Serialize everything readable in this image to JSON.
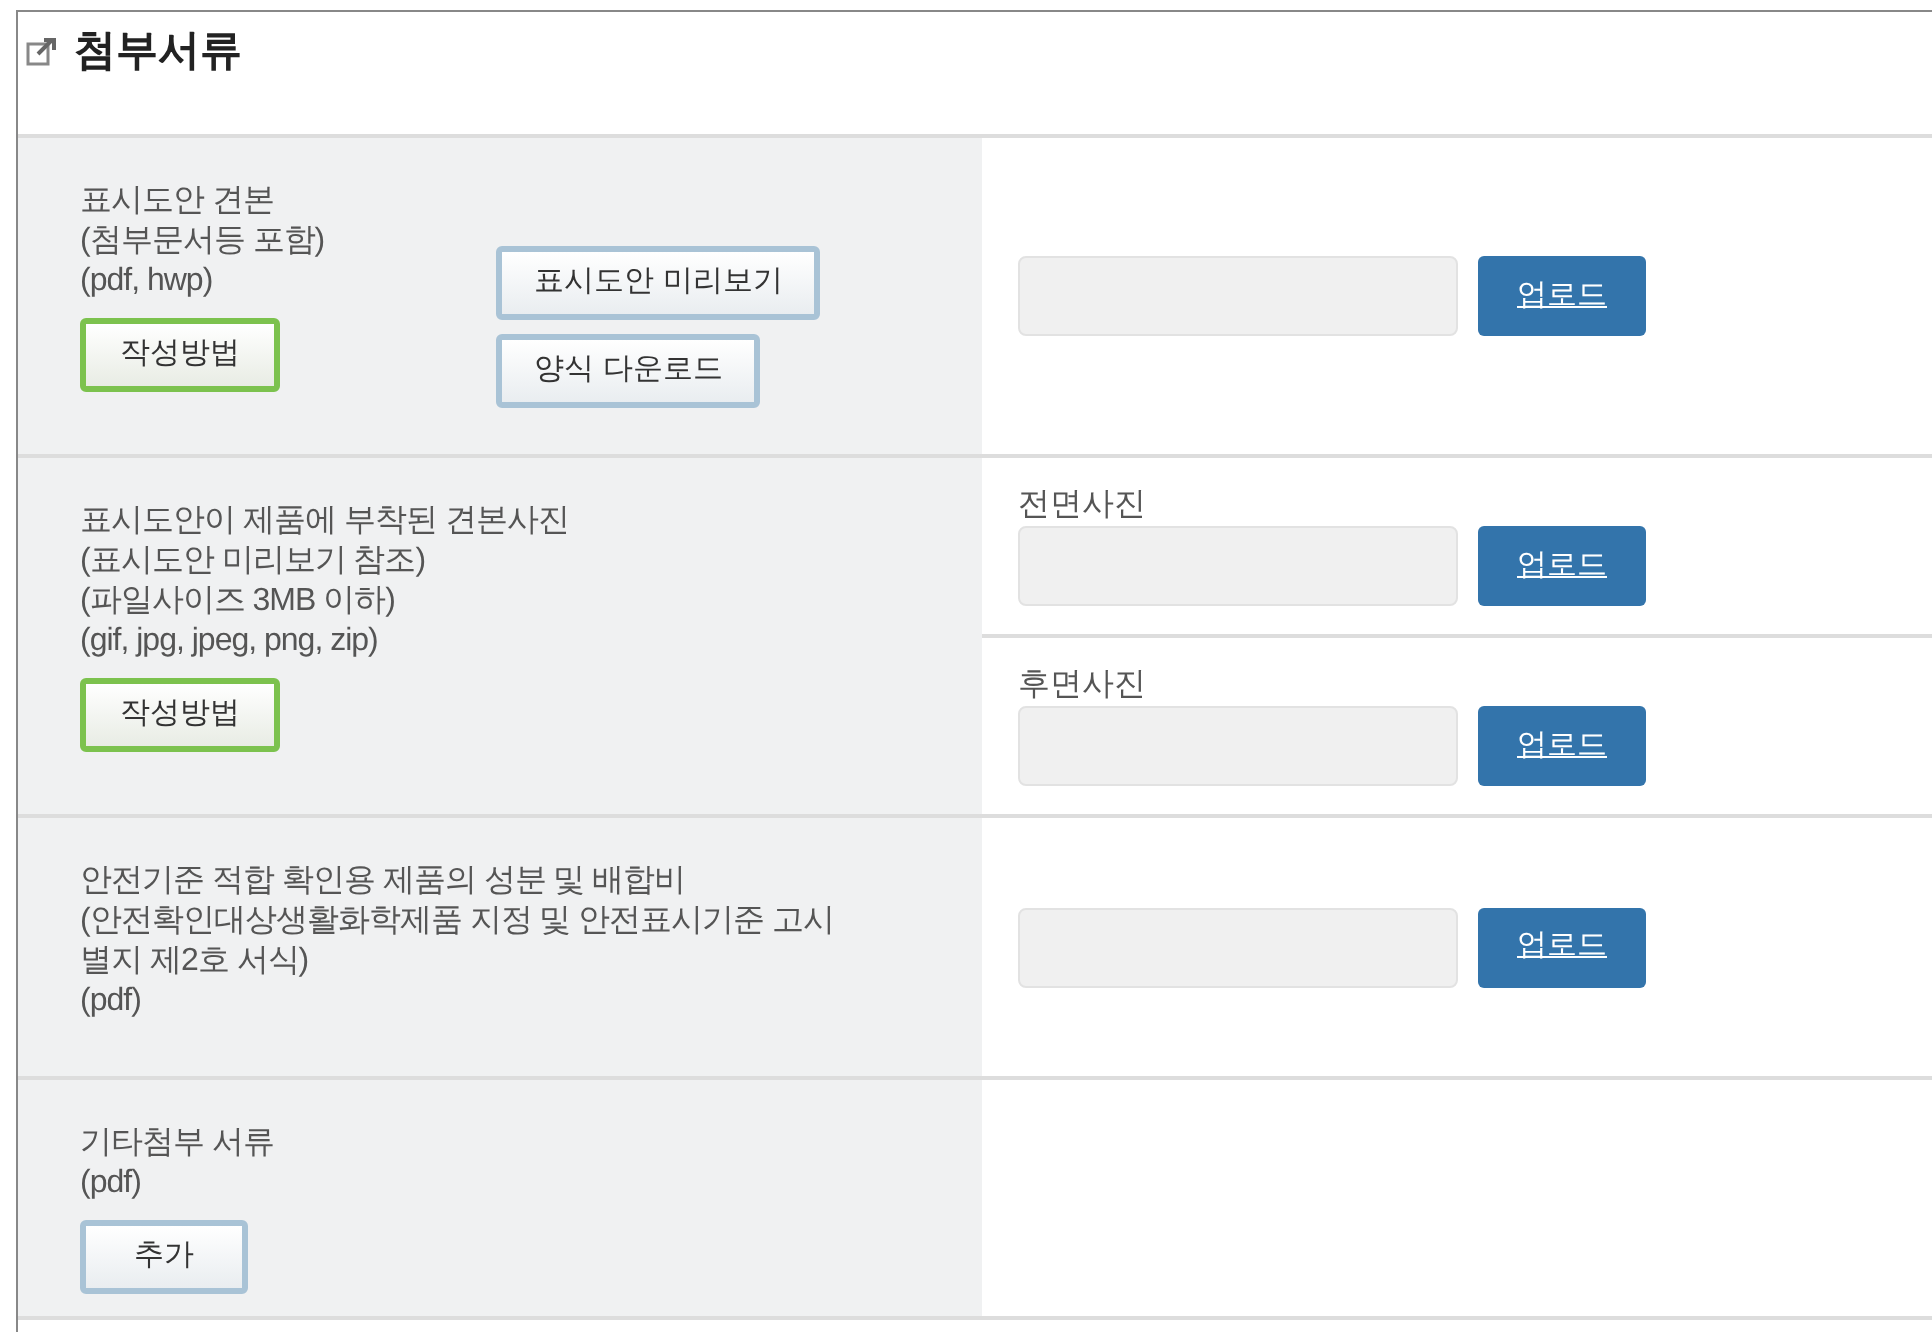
{
  "title": "첨부서류",
  "rows": [
    {
      "lines": [
        "표시도안 견본",
        "(첨부문서등 포함)",
        "(pdf, hwp)"
      ],
      "buttons": [
        {
          "kind": "guide",
          "label": "작성방법"
        }
      ],
      "side_buttons": [
        {
          "kind": "plain",
          "label": "표시도안 미리보기"
        },
        {
          "kind": "plain",
          "label": "양식 다운로드"
        }
      ],
      "uploads": [
        {
          "button": "업로드"
        }
      ]
    },
    {
      "lines": [
        "표시도안이 제품에 부착된 견본사진",
        "(표시도안 미리보기 참조)",
        "(파일사이즈 3MB 이하)",
        "(gif, jpg, jpeg, png, zip)"
      ],
      "buttons": [
        {
          "kind": "guide",
          "label": "작성방법"
        }
      ],
      "uploads": [
        {
          "caption": "전면사진",
          "button": "업로드"
        },
        {
          "caption": "후면사진",
          "button": "업로드"
        }
      ]
    },
    {
      "lines": [
        "안전기준 적합 확인용 제품의 성분 및 배합비",
        "(안전확인대상생활화학제품 지정 및 안전표시기준 고시",
        "별지 제2호 서식)",
        "(pdf)"
      ],
      "uploads": [
        {
          "button": "업로드"
        }
      ]
    },
    {
      "lines": [
        "기타첨부 서류",
        "(pdf)"
      ],
      "buttons": [
        {
          "kind": "plain",
          "label": "추가"
        }
      ]
    }
  ]
}
